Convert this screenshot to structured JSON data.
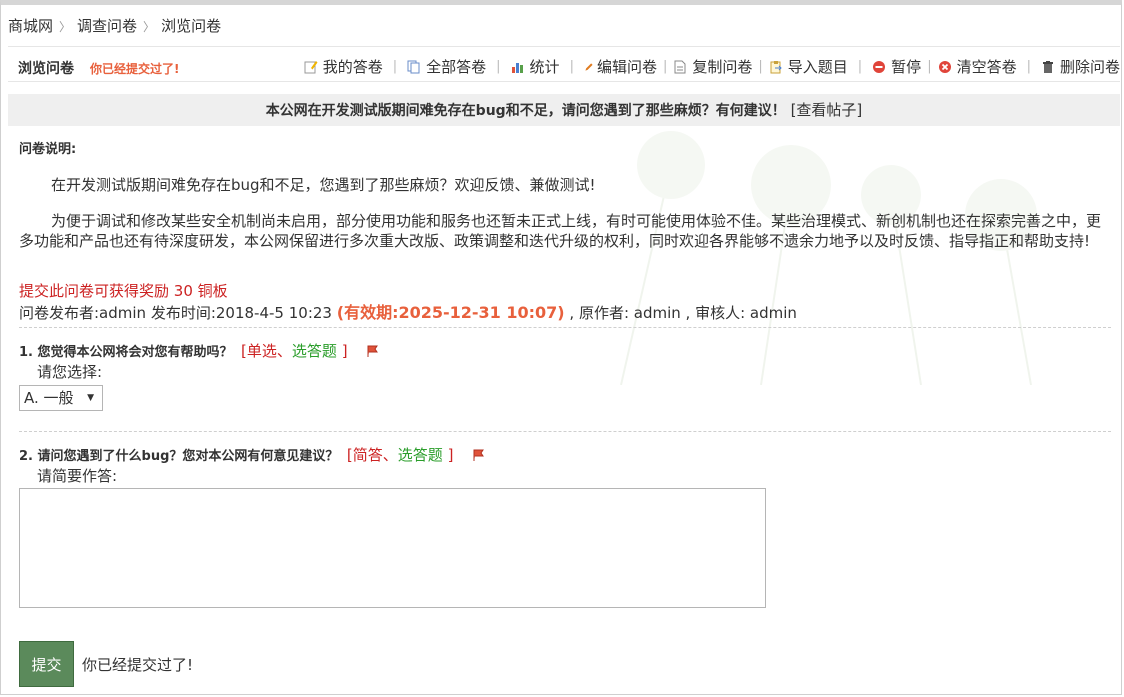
{
  "breadcrumb": [
    "商城网",
    "调查问卷",
    "浏览问卷"
  ],
  "toolbar": {
    "title": "浏览问卷",
    "status": "你已经提交过了!",
    "actions": [
      {
        "label": "我的答卷",
        "icon": "pencil-paper-icon"
      },
      {
        "label": "全部答卷",
        "icon": "copy-documents-icon"
      },
      {
        "label": "统计",
        "icon": "bar-chart-icon"
      },
      {
        "label": "编辑问卷",
        "icon": "pencil-icon"
      },
      {
        "label": "复制问卷",
        "icon": "document-icon"
      },
      {
        "label": "导入题目",
        "icon": "import-icon"
      },
      {
        "label": "暂停",
        "icon": "pause-icon"
      },
      {
        "label": "清空答卷",
        "icon": "clear-icon"
      },
      {
        "label": "删除问卷",
        "icon": "trash-icon"
      }
    ]
  },
  "notice": {
    "text": "本公网在开发测试版期间难免存在bug和不足，请问您遇到了那些麻烦？有何建议！",
    "link": "[查看帖子]"
  },
  "description": {
    "label": "问卷说明:",
    "para1": "在开发测试版期间难免存在bug和不足，您遇到了那些麻烦？欢迎反馈、兼做测试!",
    "para2": "为便于调试和修改某些安全机制尚未启用，部分使用功能和服务也还暂未正式上线，有时可能使用体验不佳。某些治理模式、新创机制也还在探索完善之中，更多功能和产品也还有待深度研发，本公网保留进行多次重大改版、政策调整和迭代升级的权利，同时欢迎各界能够不遗余力地予以及时反馈、指导指正和帮助支持!"
  },
  "reward": "提交此问卷可获得奖励 30 铜板",
  "meta": {
    "publisher": "问卷发布者:admin 发布时间:2018-4-5 10:23",
    "expiry": "(有效期:2025-12-31 10:07)",
    "tail": ", 原作者: admin , 审核人: admin"
  },
  "questions": [
    {
      "title": "1. 您觉得本公网将会对您有帮助吗？",
      "tag_open": "[单选、",
      "tag_type": "选答题",
      "tag_close": "]",
      "hint": "请您选择:",
      "selected": "A. 一般"
    },
    {
      "title": "2. 请问您遇到了什么bug？您对本公网有何意见建议？",
      "tag_open": "[简答、",
      "tag_type": "选答题",
      "tag_close": "]",
      "hint": "请简要作答:",
      "answer": ""
    }
  ],
  "submit": {
    "label": "提交",
    "message": "你已经提交过了!"
  },
  "colors": {
    "accent_orange": "#e8603c",
    "red": "#cc2222",
    "green": "#2a9d2a",
    "submit_button": "#5b8a5b"
  }
}
